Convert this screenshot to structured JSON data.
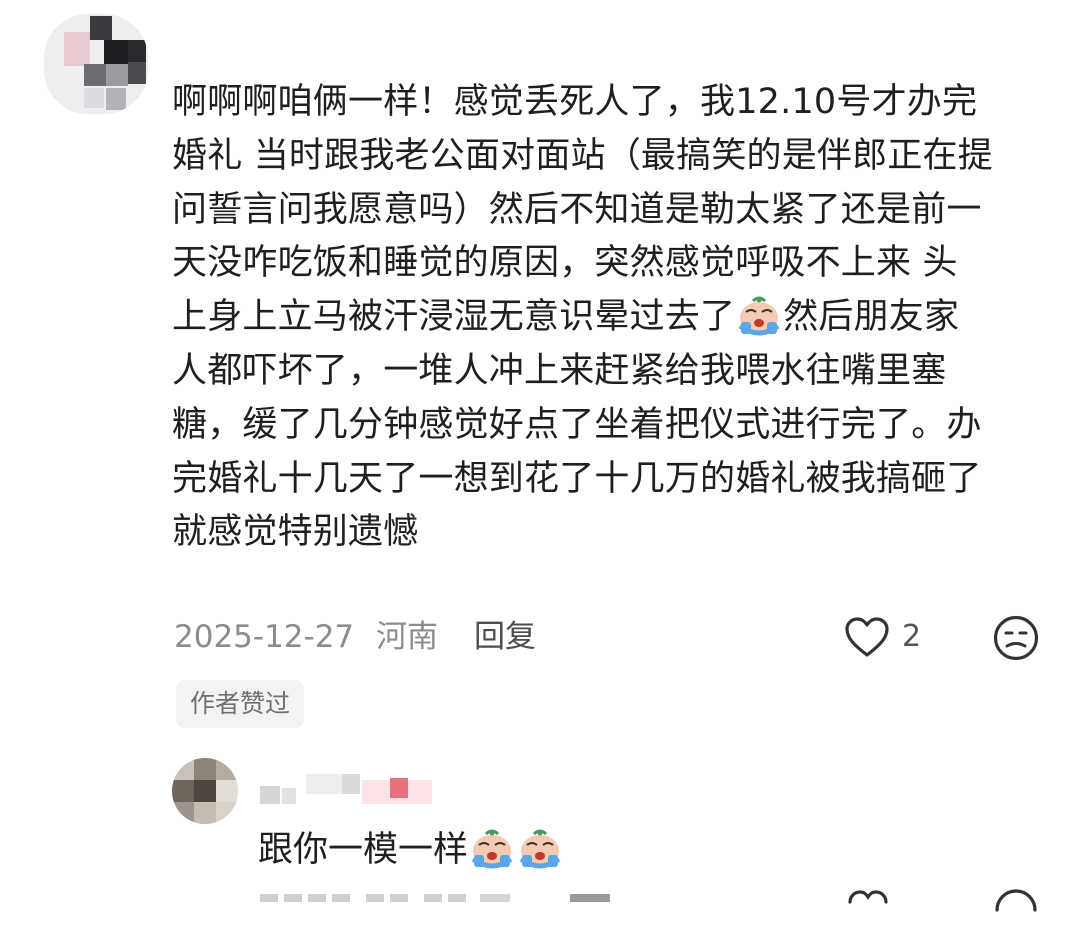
{
  "comment": {
    "text_lines": [
      "啊啊啊咱俩一样！感觉丢死人了，我12.10号才办完",
      "婚礼 当时跟我老公面对面站（最搞笑的是伴郎正在提",
      "问誓言问我愿意吗）然后不知道是勒太紧了还是前一",
      "天没咋吃饭和睡觉的原因，突然感觉呼吸不上来 头",
      "上身上立马被汗浸湿无意识晕过去了",
      "然后朋友家",
      "人都吓坏了，一堆人冲上来赶紧给我喂水往嘴里塞",
      "糖，缓了几分钟感觉好点了坐着把仪式进行完了。办",
      "完婚礼十几天了一想到花了十几万的婚礼被我搞砸了",
      "就感觉特别遗憾"
    ],
    "emoji": "crying-face-emoji",
    "date": "2025-12-27",
    "location": "河南",
    "reply_label": "回复",
    "like_count": "2",
    "author_liked_badge": "作者赞过"
  },
  "reply": {
    "text": "跟你一模一样",
    "emoji_count": 2
  },
  "colors": {
    "text": "#1f1f1f",
    "meta": "#8c8c8c",
    "badge_bg": "#f3f3f3"
  }
}
